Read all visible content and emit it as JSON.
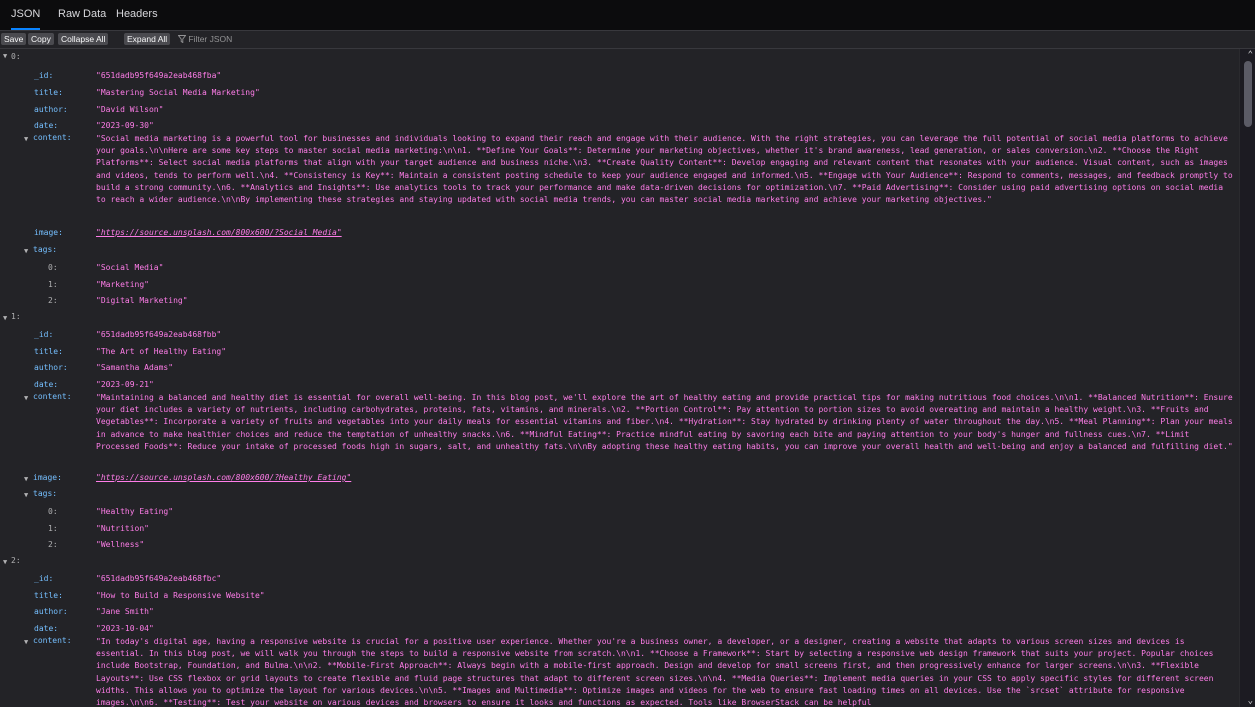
{
  "tabs": [
    "JSON",
    "Raw Data",
    "Headers"
  ],
  "toolbar": {
    "save": "Save",
    "copy": "Copy",
    "collapse_all": "Collapse All",
    "expand_all": "Expand All",
    "filter_placeholder": "Filter JSON"
  },
  "labels": {
    "id": "_id:",
    "title": "title:",
    "author": "author:",
    "date": "date:",
    "content": "content:",
    "image": "image:",
    "tags": "tags:"
  },
  "items": [
    {
      "index": "0:",
      "id": "\"651dadb95f649a2eab468fba\"",
      "title": "\"Mastering Social Media Marketing\"",
      "author": "\"David Wilson\"",
      "date": "\"2023-09-30\"",
      "content": "\"Social media marketing is a powerful tool for businesses and individuals looking to expand their reach and engage with their audience. With the right strategies, you can leverage the full potential of social media platforms to achieve your goals.\\n\\nHere are some key steps to master social media marketing:\\n\\n1. **Define Your Goals**: Determine your marketing objectives, whether it's brand awareness, lead generation, or sales conversion.\\n2. **Choose the Right Platforms**: Select social media platforms that align with your target audience and business niche.\\n3. **Create Quality Content**: Develop engaging and relevant content that resonates with your audience. Visual content, such as images and videos, tends to perform well.\\n4. **Consistency is Key**: Maintain a consistent posting schedule to keep your audience engaged and informed.\\n5. **Engage with Your Audience**: Respond to comments, messages, and feedback promptly to build a strong community.\\n6. **Analytics and Insights**: Use analytics tools to track your performance and make data-driven decisions for optimization.\\n7. **Paid Advertising**: Consider using paid advertising options on social media to reach a wider audience.\\n\\nBy implementing these strategies and staying updated with social media trends, you can master social media marketing and achieve your marketing objectives.\"",
      "image": "\"https://source.unsplash.com/800x600/?Social Media\"",
      "tags": [
        "\"Social Media\"",
        "\"Marketing\"",
        "\"Digital Marketing\""
      ]
    },
    {
      "index": "1:",
      "id": "\"651dadb95f649a2eab468fbb\"",
      "title": "\"The Art of Healthy Eating\"",
      "author": "\"Samantha Adams\"",
      "date": "\"2023-09-21\"",
      "content": "\"Maintaining a balanced and healthy diet is essential for overall well-being. In this blog post, we'll explore the art of healthy eating and provide practical tips for making nutritious food choices.\\n\\n1. **Balanced Nutrition**: Ensure your diet includes a variety of nutrients, including carbohydrates, proteins, fats, vitamins, and minerals.\\n2. **Portion Control**: Pay attention to portion sizes to avoid overeating and maintain a healthy weight.\\n3. **Fruits and Vegetables**: Incorporate a variety of fruits and vegetables into your daily meals for essential vitamins and fiber.\\n4. **Hydration**: Stay hydrated by drinking plenty of water throughout the day.\\n5. **Meal Planning**: Plan your meals in advance to make healthier choices and reduce the temptation of unhealthy snacks.\\n6. **Mindful Eating**: Practice mindful eating by savoring each bite and paying attention to your body's hunger and fullness cues.\\n7. **Limit Processed Foods**: Reduce your intake of processed foods high in sugars, salt, and unhealthy fats.\\n\\nBy adopting these healthy eating habits, you can improve your overall health and well-being and enjoy a balanced and fulfilling diet.\"",
      "image": "\"https://source.unsplash.com/800x600/?Healthy Eating\"",
      "tags": [
        "\"Healthy Eating\"",
        "\"Nutrition\"",
        "\"Wellness\""
      ]
    },
    {
      "index": "2:",
      "id": "\"651dadb95f649a2eab468fbc\"",
      "title": "\"How to Build a Responsive Website\"",
      "author": "\"Jane Smith\"",
      "date": "\"2023-10-04\"",
      "content": "\"In today's digital age, having a responsive website is crucial for a positive user experience. Whether you're a business owner, a developer, or a designer, creating a website that adapts to various screen sizes and devices is essential. In this blog post, we will walk you through the steps to build a responsive website from scratch.\\n\\n1. **Choose a Framework**: Start by selecting a responsive web design framework that suits your project. Popular choices include Bootstrap, Foundation, and Bulma.\\n\\n2. **Mobile-First Approach**: Always begin with a mobile-first approach. Design and develop for small screens first, and then progressively enhance for larger screens.\\n\\n3. **Flexible Layouts**: Use CSS flexbox or grid layouts to create flexible and fluid page structures that adapt to different screen sizes.\\n\\n4. **Media Queries**: Implement media queries in your CSS to apply specific styles for different screen widths. This allows you to optimize the layout for various devices.\\n\\n5. **Images and Multimedia**: Optimize images and videos for the web to ensure fast loading times on all devices. Use the `srcset` attribute for responsive images.\\n\\n6. **Testing**: Test your website on various devices and browsers to ensure it looks and functions as expected. Tools like BrowserStack can be helpful"
    }
  ]
}
